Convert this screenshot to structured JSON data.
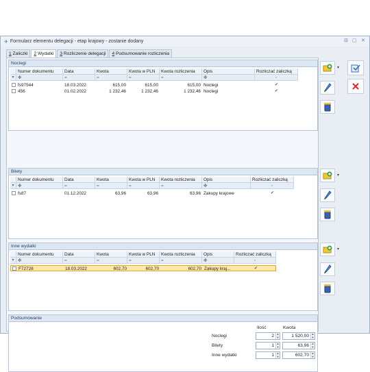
{
  "window": {
    "title": "Formularz elementu delegacji - etap krajowy - zostanie dodany",
    "controls": [
      "⊟",
      "▢",
      "✕"
    ]
  },
  "tabs": [
    {
      "num": "1",
      "label": " Zaliczki"
    },
    {
      "num": "2",
      "label": " Wydatki"
    },
    {
      "num": "3",
      "label": " Rozliczenie delegacji"
    },
    {
      "num": "4",
      "label": " Podsumowanie rozliczenia"
    }
  ],
  "sections": {
    "noclegi": {
      "title": "Noclegi",
      "columns": [
        "Numer dokumentu",
        "Data",
        "Kwota",
        "Kwota w PLN",
        "Kwota rozliczenia",
        "Opis",
        "Rozliczać zaliczką"
      ],
      "rows": [
        {
          "doc": "fs97544",
          "date": "18.03.2022",
          "amount": "615,00",
          "amount_pln": "615,00",
          "settle": "615,00",
          "desc": "Noclegi",
          "advance": true
        },
        {
          "doc": "456",
          "date": "01.02.2022",
          "amount": "1 232,46",
          "amount_pln": "1 232,46",
          "settle": "1 232,46",
          "desc": "Noclegi",
          "advance": true
        }
      ]
    },
    "bilety": {
      "title": "Bilety",
      "columns": [
        "Numer dokumentu",
        "Data",
        "Kwota",
        "Kwota w PLN",
        "Kwota rozliczenia",
        "Opis",
        "Rozliczać zaliczką"
      ],
      "rows": [
        {
          "doc": "fs87",
          "date": "01.12.2022",
          "amount": "63,96",
          "amount_pln": "63,96",
          "settle": "63,96",
          "desc": "Zakupy krajowe",
          "advance": true
        }
      ]
    },
    "inne": {
      "title": "Inne wydatki",
      "columns": [
        "Numer dokumentu",
        "Data",
        "Kwota",
        "Kwota w PLN",
        "Kwota rozliczenia",
        "Opis",
        "Rozliczać zaliczką"
      ],
      "rows": [
        {
          "doc": "F72728",
          "date": "18.03.2022",
          "amount": "602,70",
          "amount_pln": "602,70",
          "settle": "602,70",
          "desc": "Zakupy kraj...",
          "advance": true
        }
      ]
    }
  },
  "summary": {
    "title": "Podsumowanie",
    "col_qty": "Ilość",
    "col_amount": "Kwota",
    "rows": [
      {
        "label": "Noclegi",
        "qty": "2",
        "amount": "1 520,00"
      },
      {
        "label": "Bilety",
        "qty": "1",
        "amount": "63,96"
      },
      {
        "label": "Inne wydatki",
        "qty": "1",
        "amount": "602,70"
      }
    ]
  },
  "colors": {
    "accent": "#3a6fb0",
    "selected_row": "#fde9a6",
    "cancel": "#d9262a",
    "add_icon": "#3f9f3f"
  }
}
